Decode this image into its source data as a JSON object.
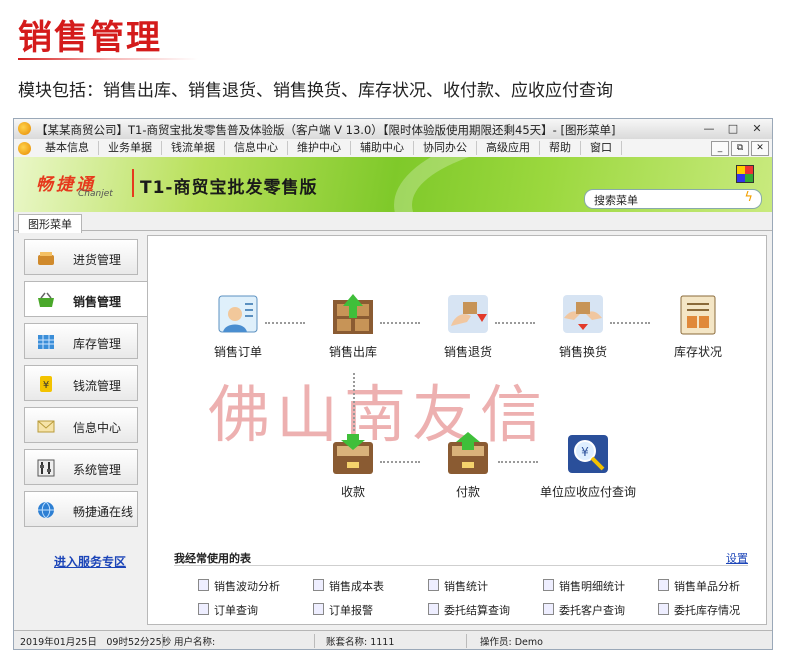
{
  "header": {
    "title": "销售管理",
    "description": "模块包括：销售出库、销售退货、销售换货、库存状况、收付款、应收应付查询"
  },
  "window": {
    "title": "【某某商贸公司】T1-商贸宝批发零售普及体验版（客户端 V 13.0）【限时体验版使用期限还剩45天】- [图形菜单]",
    "buttons": {
      "minimize": "—",
      "maximize": "□",
      "close": "✕"
    }
  },
  "menubar": {
    "items": [
      "基本信息",
      "业务单据",
      "钱流单据",
      "信息中心",
      "维护中心",
      "辅助中心",
      "协同办公",
      "高级应用",
      "帮助",
      "窗口"
    ],
    "buttons": {
      "minimize": "_",
      "restore": "⧉",
      "close": "✕"
    }
  },
  "banner": {
    "logo_cn": "畅捷通",
    "logo_en": "Chanjet",
    "product": "T1-商贸宝批发零售版",
    "search_placeholder": "搜索菜单"
  },
  "tabs": [
    {
      "label": "图形菜单"
    }
  ],
  "sidebar": {
    "items": [
      {
        "label": "进货管理",
        "icon": "basket-icon"
      },
      {
        "label": "销售管理",
        "icon": "cart-icon",
        "active": true
      },
      {
        "label": "库存管理",
        "icon": "grid-icon"
      },
      {
        "label": "钱流管理",
        "icon": "money-icon"
      },
      {
        "label": "信息中心",
        "icon": "mail-icon"
      },
      {
        "label": "系统管理",
        "icon": "settings-icon"
      },
      {
        "label": "畅捷通在线",
        "icon": "globe-icon"
      }
    ],
    "service_link": "进入服务专区"
  },
  "flow": {
    "nodes": [
      {
        "label": "销售订单",
        "icon": "order-doc-icon"
      },
      {
        "label": "销售出库",
        "icon": "outbound-icon"
      },
      {
        "label": "销售退货",
        "icon": "return-icon"
      },
      {
        "label": "销售换货",
        "icon": "exchange-icon"
      },
      {
        "label": "库存状况",
        "icon": "inventory-icon"
      },
      {
        "label": "收款",
        "icon": "receive-money-icon"
      },
      {
        "label": "付款",
        "icon": "pay-money-icon"
      },
      {
        "label": "单位应收应付查询",
        "icon": "query-icon"
      }
    ]
  },
  "watermark": "佛山南友信",
  "frequent": {
    "title": "我经常使用的表",
    "settings": "设置",
    "items": [
      "销售波动分析",
      "销售成本表",
      "销售统计",
      "销售明细统计",
      "销售单品分析",
      "订单查询",
      "订单报警",
      "委托结算查询",
      "委托客户查询",
      "委托库存情况"
    ]
  },
  "status": {
    "datetime": "2019年01月25日　09时52分25秒",
    "user": "用户名称:",
    "account": "账套名称: 1111",
    "operator": "操作员: Demo"
  },
  "colors": {
    "title_red": "#d41b1b",
    "link_blue": "#1c45b8",
    "banner_green": "#7fc92a"
  }
}
